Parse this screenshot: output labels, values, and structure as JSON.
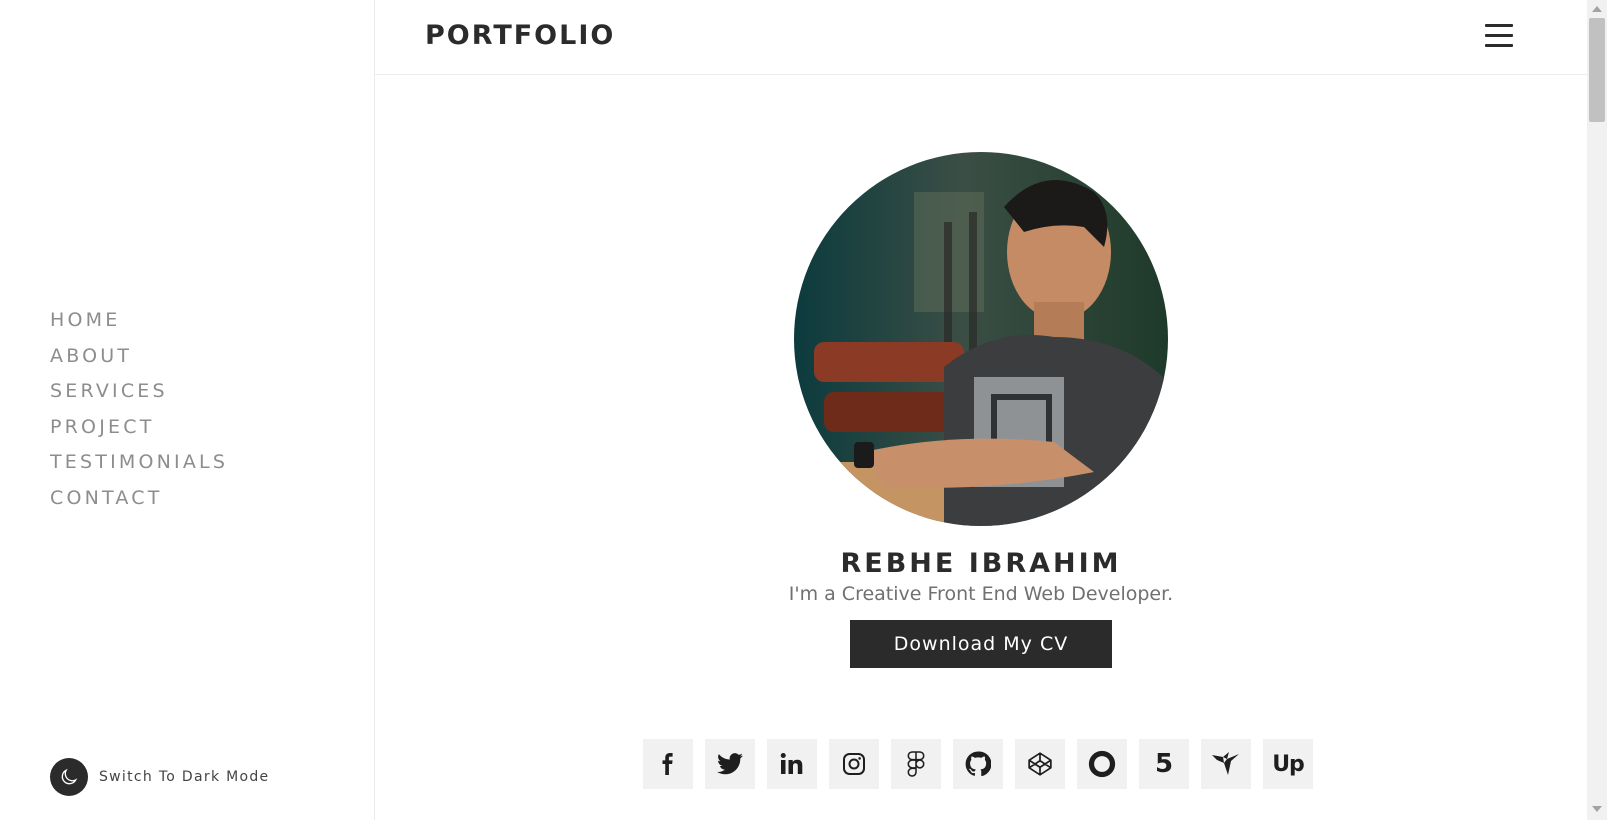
{
  "brand": "PORTFOLIO",
  "nav": [
    "HOME",
    "ABOUT",
    "SERVICES",
    "PROJECT",
    "TESTIMONIALS",
    "CONTACT"
  ],
  "dark_mode_label": "Switch To Dark Mode",
  "hero": {
    "name": "REBHE IBRAHIM",
    "tagline": "I'm a Creative Front End Web Developer.",
    "cv_button": "Download My CV"
  },
  "socials": [
    "facebook-icon",
    "twitter-icon",
    "linkedin-icon",
    "instagram-icon",
    "figma-icon",
    "github-icon",
    "codepen-icon",
    "opencollective-icon",
    "500px-icon",
    "freelancer-icon",
    "upwork-icon"
  ],
  "colors": {
    "dark": "#2b2b2b",
    "nav_text": "#8d8d8d",
    "tile_bg": "#f1f1f1"
  }
}
